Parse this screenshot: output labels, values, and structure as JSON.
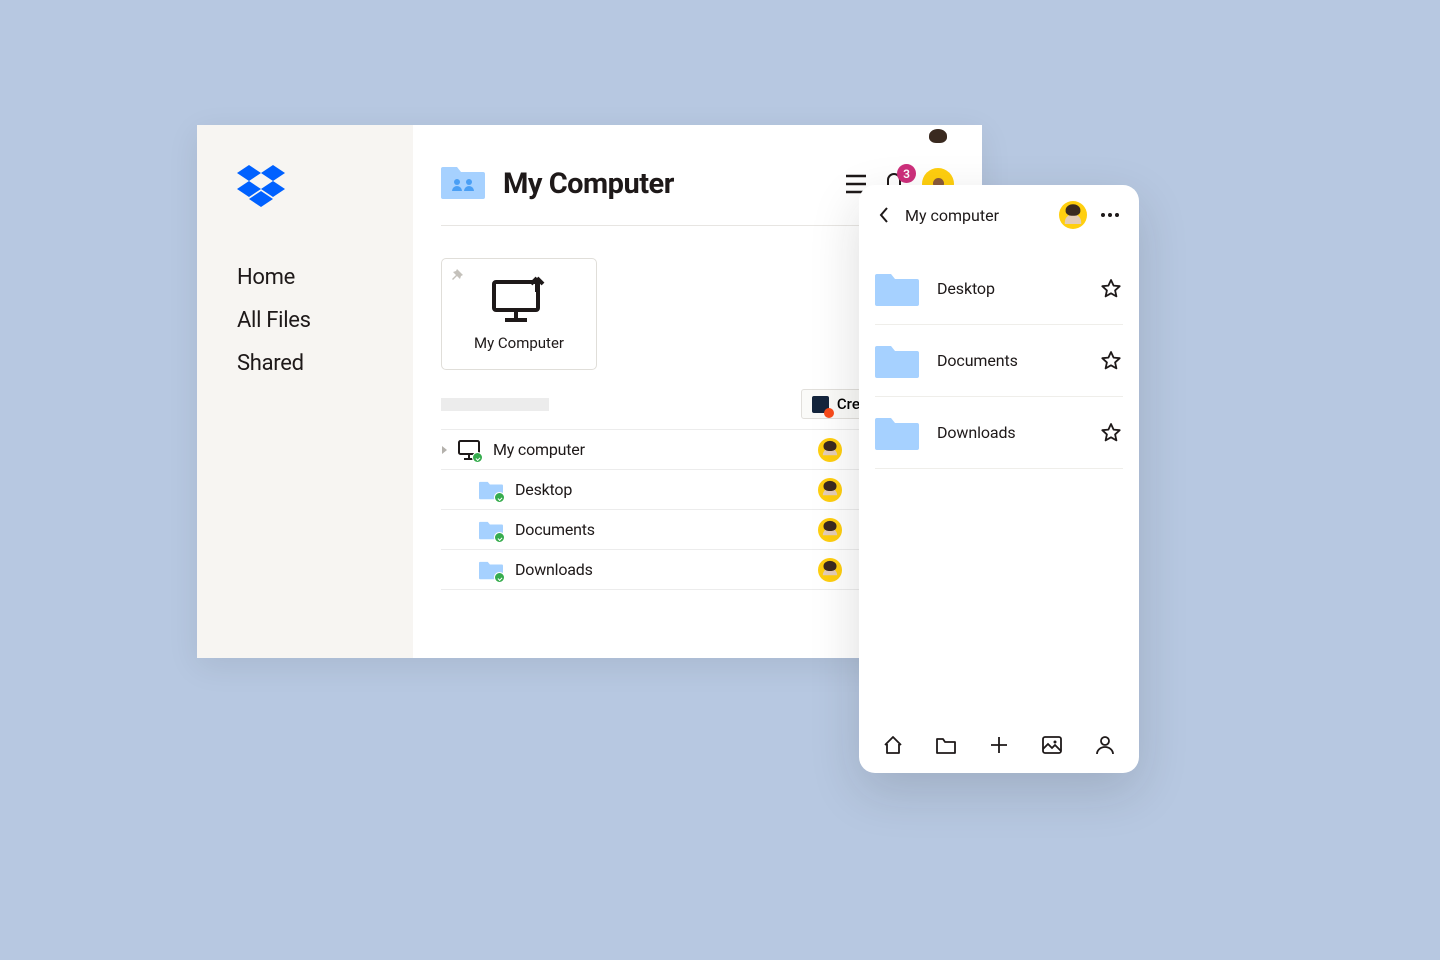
{
  "sidebar": {
    "items": [
      "Home",
      "All Files",
      "Shared"
    ]
  },
  "header": {
    "title": "My Computer",
    "notification_count": "3"
  },
  "tile": {
    "label": "My Computer"
  },
  "toolbar": {
    "create_label": "Create"
  },
  "rows": [
    {
      "name": "My computer",
      "indent": 0,
      "icon": "computer"
    },
    {
      "name": "Desktop",
      "indent": 1,
      "icon": "folder"
    },
    {
      "name": "Documents",
      "indent": 1,
      "icon": "folder"
    },
    {
      "name": "Downloads",
      "indent": 1,
      "icon": "folder"
    }
  ],
  "mobile": {
    "title": "My computer",
    "items": [
      "Desktop",
      "Documents",
      "Downloads"
    ]
  }
}
